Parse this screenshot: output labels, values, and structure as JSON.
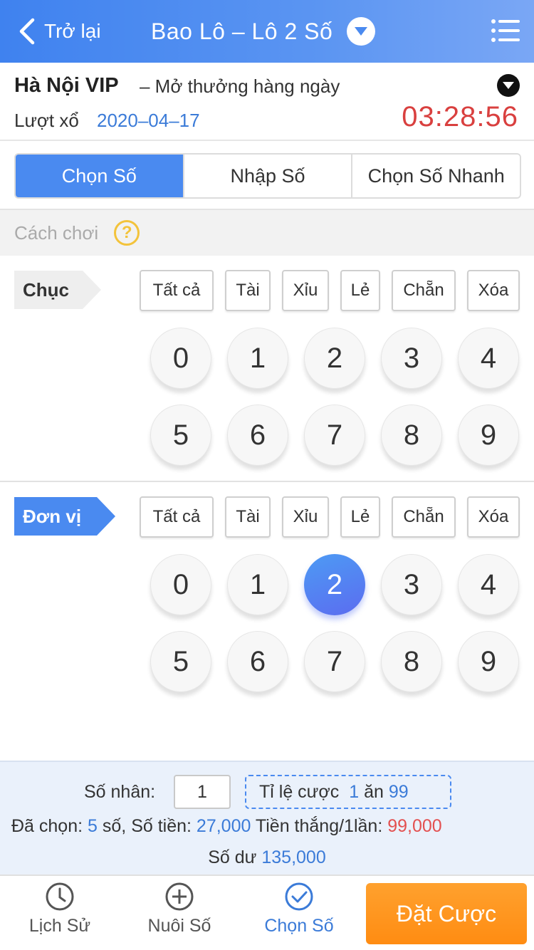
{
  "header": {
    "back_label": "Trở lại",
    "title": "Bao Lô – Lô 2 Số"
  },
  "lottery": {
    "name": "Hà Nội VIP",
    "description": "– Mở thưởng hàng ngày",
    "draw_label": "Lượt xổ",
    "draw_date": "2020–04–17",
    "countdown": "03:28:56"
  },
  "tabs": [
    {
      "label": "Chọn Số",
      "active": true
    },
    {
      "label": "Nhập Số",
      "active": false
    },
    {
      "label": "Chọn Số Nhanh",
      "active": false
    }
  ],
  "guide": {
    "label": "Cách chơi",
    "help": "?"
  },
  "quick_buttons": [
    "Tất cả",
    "Tài",
    "Xỉu",
    "Lẻ",
    "Chẵn",
    "Xóa"
  ],
  "sections": [
    {
      "label": "Chục",
      "selected": []
    },
    {
      "label": "Đơn vị",
      "selected": [
        "2"
      ]
    }
  ],
  "digits": [
    "0",
    "1",
    "2",
    "3",
    "4",
    "5",
    "6",
    "7",
    "8",
    "9"
  ],
  "summary": {
    "multiplier_label": "Số nhân:",
    "multiplier_value": "1",
    "odds_label": "Tỉ lệ cược",
    "odds_stake": "1",
    "odds_mid": "ăn",
    "odds_payout": "99",
    "selected_label": "Đã chọn:",
    "selected_count": "5",
    "selected_unit": "số,",
    "amount_label": "Số tiền:",
    "amount_value": "27,000",
    "win_label": "Tiền thắng/1lần:",
    "win_value": "99,000",
    "balance_label": "Số dư",
    "balance_value": "135,000"
  },
  "bottom_nav": [
    {
      "label": "Lịch Sử",
      "icon": "clock-icon",
      "active": false
    },
    {
      "label": "Nuôi Số",
      "icon": "plus-circle-icon",
      "active": false
    },
    {
      "label": "Chọn Số",
      "icon": "check-circle-icon",
      "active": true
    }
  ],
  "bet_button": "Đặt Cược",
  "colors": {
    "primary": "#4a8af0",
    "countdown": "#d9403f",
    "accent_orange": "#ff8c12",
    "help_yellow": "#f3c33b"
  }
}
